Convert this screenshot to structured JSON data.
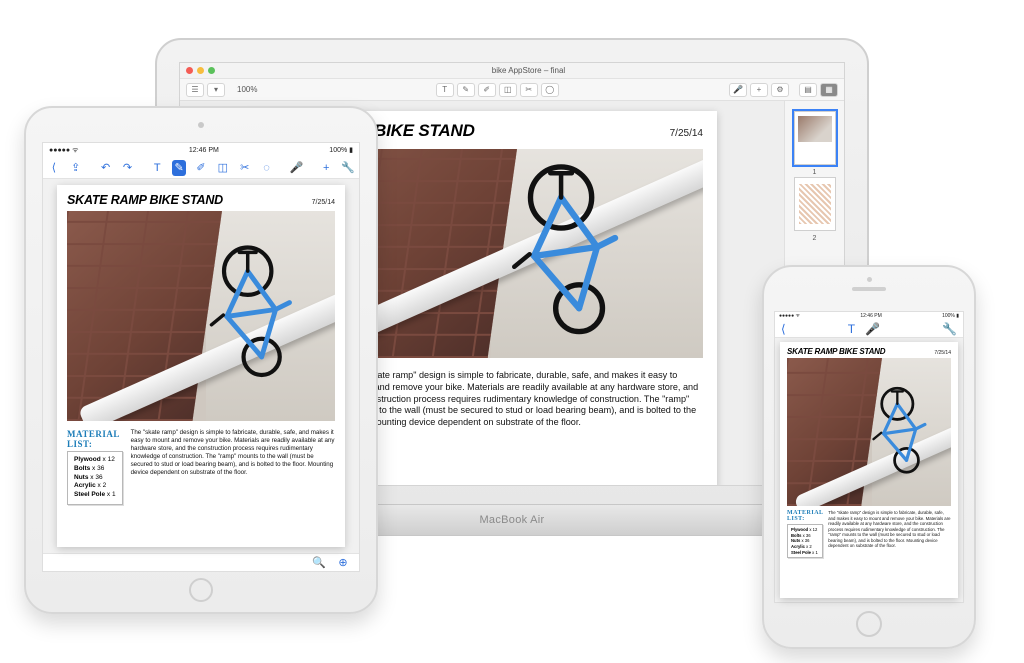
{
  "mac": {
    "window_title": "bike AppStore – final",
    "zoom": "100%",
    "brand": "MacBook Air",
    "thumbs": [
      {
        "num": "1",
        "selected": true
      },
      {
        "num": "2",
        "selected": false
      }
    ]
  },
  "ipad": {
    "carrier": "●●●●●  ᯤ",
    "clock": "12:46 PM",
    "battery": "100% ▮"
  },
  "doc": {
    "title": "SKATE RAMP BIKE STAND",
    "date": "7/25/14",
    "date_short": "7/25/14",
    "material_label": "MATERIAL LIST:",
    "materials": [
      {
        "name": "Plywood",
        "qty": "12"
      },
      {
        "name": "Bolts",
        "qty": "36"
      },
      {
        "name": "Nuts",
        "qty": "36"
      },
      {
        "name": "Acrylic",
        "qty": "2"
      },
      {
        "name": "Steel Pole",
        "qty": "1"
      }
    ],
    "paragraph": "The \"skate ramp\" design is simple to fabricate, durable, safe, and makes it easy to mount and remove your bike. Materials are readily available at any hardware store, and the construction process requires rudimentary knowledge of construction. The \"ramp\" mounts to the wall (must be secured to stud or load bearing beam), and is bolted to the floor. Mounting device dependent on substrate of the floor."
  },
  "icons": {
    "share": "⇪",
    "undo": "↶",
    "redo": "↷",
    "text": "T",
    "marker": "✎",
    "pencil": "✐",
    "eraser": "◫",
    "scissors": "✂",
    "lasso": "◌",
    "mic": "🎤",
    "plus": "+",
    "settings": "🔧",
    "zoom_in": "⊕",
    "zoom_out": "🔍",
    "thumbnails": "▦",
    "page": "▤"
  }
}
